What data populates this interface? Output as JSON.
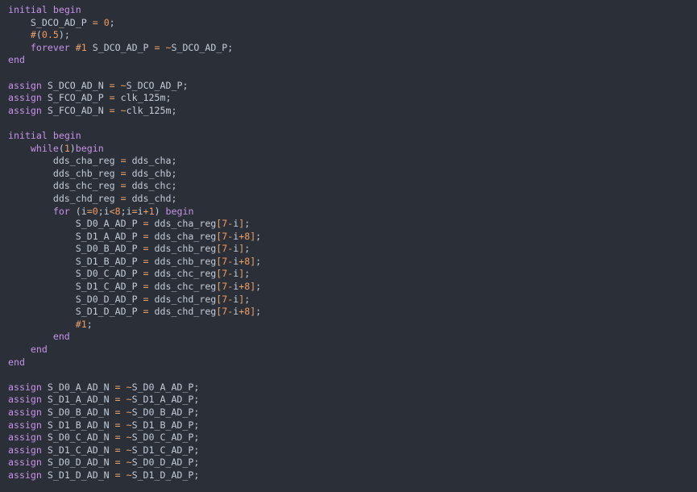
{
  "colors": {
    "background": "#2b2f37",
    "keyword": "#c792ea",
    "number": "#f59a5f",
    "operator": "#e8a36d",
    "identifier": "#c3ccd8"
  },
  "code_lines": [
    [
      {
        "k": "kw",
        "t": "initial"
      },
      {
        "k": "ws",
        "t": " "
      },
      {
        "k": "kw",
        "t": "begin"
      }
    ],
    [
      {
        "k": "ws",
        "t": "    "
      },
      {
        "k": "id",
        "t": "S_DCO_AD_P"
      },
      {
        "k": "ws",
        "t": " "
      },
      {
        "k": "op",
        "t": "="
      },
      {
        "k": "ws",
        "t": " "
      },
      {
        "k": "num",
        "t": "0"
      },
      {
        "k": "punc",
        "t": ";"
      }
    ],
    [
      {
        "k": "ws",
        "t": "    "
      },
      {
        "k": "op",
        "t": "#"
      },
      {
        "k": "punc",
        "t": "("
      },
      {
        "k": "num",
        "t": "0.5"
      },
      {
        "k": "punc",
        "t": ");"
      }
    ],
    [
      {
        "k": "ws",
        "t": "    "
      },
      {
        "k": "kw",
        "t": "forever"
      },
      {
        "k": "ws",
        "t": " "
      },
      {
        "k": "op",
        "t": "#"
      },
      {
        "k": "num",
        "t": "1"
      },
      {
        "k": "ws",
        "t": " "
      },
      {
        "k": "id",
        "t": "S_DCO_AD_P"
      },
      {
        "k": "ws",
        "t": " "
      },
      {
        "k": "op",
        "t": "="
      },
      {
        "k": "ws",
        "t": " "
      },
      {
        "k": "op",
        "t": "~"
      },
      {
        "k": "id",
        "t": "S_DCO_AD_P"
      },
      {
        "k": "punc",
        "t": ";"
      }
    ],
    [
      {
        "k": "kw",
        "t": "end"
      }
    ],
    [],
    [
      {
        "k": "kw",
        "t": "assign"
      },
      {
        "k": "ws",
        "t": " "
      },
      {
        "k": "id",
        "t": "S_DCO_AD_N"
      },
      {
        "k": "ws",
        "t": " "
      },
      {
        "k": "op",
        "t": "="
      },
      {
        "k": "ws",
        "t": " "
      },
      {
        "k": "op",
        "t": "~"
      },
      {
        "k": "id",
        "t": "S_DCO_AD_P"
      },
      {
        "k": "punc",
        "t": ";"
      }
    ],
    [
      {
        "k": "kw",
        "t": "assign"
      },
      {
        "k": "ws",
        "t": " "
      },
      {
        "k": "id",
        "t": "S_FCO_AD_P"
      },
      {
        "k": "ws",
        "t": " "
      },
      {
        "k": "op",
        "t": "="
      },
      {
        "k": "ws",
        "t": " "
      },
      {
        "k": "id",
        "t": "clk_125m"
      },
      {
        "k": "punc",
        "t": ";"
      }
    ],
    [
      {
        "k": "kw",
        "t": "assign"
      },
      {
        "k": "ws",
        "t": " "
      },
      {
        "k": "id",
        "t": "S_FCO_AD_N"
      },
      {
        "k": "ws",
        "t": " "
      },
      {
        "k": "op",
        "t": "="
      },
      {
        "k": "ws",
        "t": " "
      },
      {
        "k": "op",
        "t": "~"
      },
      {
        "k": "id",
        "t": "clk_125m"
      },
      {
        "k": "punc",
        "t": ";"
      }
    ],
    [],
    [
      {
        "k": "kw",
        "t": "initial"
      },
      {
        "k": "ws",
        "t": " "
      },
      {
        "k": "kw",
        "t": "begin"
      }
    ],
    [
      {
        "k": "ws",
        "t": "    "
      },
      {
        "k": "kw",
        "t": "while"
      },
      {
        "k": "punc",
        "t": "("
      },
      {
        "k": "num",
        "t": "1"
      },
      {
        "k": "punc",
        "t": ")"
      },
      {
        "k": "kw",
        "t": "begin"
      }
    ],
    [
      {
        "k": "ws",
        "t": "        "
      },
      {
        "k": "id",
        "t": "dds_cha_reg"
      },
      {
        "k": "ws",
        "t": " "
      },
      {
        "k": "op",
        "t": "="
      },
      {
        "k": "ws",
        "t": " "
      },
      {
        "k": "id",
        "t": "dds_cha"
      },
      {
        "k": "punc",
        "t": ";"
      }
    ],
    [
      {
        "k": "ws",
        "t": "        "
      },
      {
        "k": "id",
        "t": "dds_chb_reg"
      },
      {
        "k": "ws",
        "t": " "
      },
      {
        "k": "op",
        "t": "="
      },
      {
        "k": "ws",
        "t": " "
      },
      {
        "k": "id",
        "t": "dds_chb"
      },
      {
        "k": "punc",
        "t": ";"
      }
    ],
    [
      {
        "k": "ws",
        "t": "        "
      },
      {
        "k": "id",
        "t": "dds_chc_reg"
      },
      {
        "k": "ws",
        "t": " "
      },
      {
        "k": "op",
        "t": "="
      },
      {
        "k": "ws",
        "t": " "
      },
      {
        "k": "id",
        "t": "dds_chc"
      },
      {
        "k": "punc",
        "t": ";"
      }
    ],
    [
      {
        "k": "ws",
        "t": "        "
      },
      {
        "k": "id",
        "t": "dds_chd_reg"
      },
      {
        "k": "ws",
        "t": " "
      },
      {
        "k": "op",
        "t": "="
      },
      {
        "k": "ws",
        "t": " "
      },
      {
        "k": "id",
        "t": "dds_chd"
      },
      {
        "k": "punc",
        "t": ";"
      }
    ],
    [
      {
        "k": "ws",
        "t": "        "
      },
      {
        "k": "kw",
        "t": "for"
      },
      {
        "k": "ws",
        "t": " "
      },
      {
        "k": "punc",
        "t": "("
      },
      {
        "k": "id",
        "t": "i"
      },
      {
        "k": "op",
        "t": "="
      },
      {
        "k": "num",
        "t": "0"
      },
      {
        "k": "punc",
        "t": ";"
      },
      {
        "k": "id",
        "t": "i"
      },
      {
        "k": "op",
        "t": "<"
      },
      {
        "k": "num",
        "t": "8"
      },
      {
        "k": "punc",
        "t": ";"
      },
      {
        "k": "id",
        "t": "i"
      },
      {
        "k": "op",
        "t": "="
      },
      {
        "k": "id",
        "t": "i"
      },
      {
        "k": "op",
        "t": "+"
      },
      {
        "k": "num",
        "t": "1"
      },
      {
        "k": "punc",
        "t": ")"
      },
      {
        "k": "ws",
        "t": " "
      },
      {
        "k": "kw",
        "t": "begin"
      }
    ],
    [
      {
        "k": "ws",
        "t": "            "
      },
      {
        "k": "id",
        "t": "S_D0_A_AD_P"
      },
      {
        "k": "ws",
        "t": " "
      },
      {
        "k": "op",
        "t": "="
      },
      {
        "k": "ws",
        "t": " "
      },
      {
        "k": "id",
        "t": "dds_cha_reg"
      },
      {
        "k": "op",
        "t": "["
      },
      {
        "k": "num",
        "t": "7"
      },
      {
        "k": "op",
        "t": "-"
      },
      {
        "k": "id",
        "t": "i"
      },
      {
        "k": "op",
        "t": "]"
      },
      {
        "k": "punc",
        "t": ";"
      }
    ],
    [
      {
        "k": "ws",
        "t": "            "
      },
      {
        "k": "id",
        "t": "S_D1_A_AD_P"
      },
      {
        "k": "ws",
        "t": " "
      },
      {
        "k": "op",
        "t": "="
      },
      {
        "k": "ws",
        "t": " "
      },
      {
        "k": "id",
        "t": "dds_cha_reg"
      },
      {
        "k": "op",
        "t": "["
      },
      {
        "k": "num",
        "t": "7"
      },
      {
        "k": "op",
        "t": "-"
      },
      {
        "k": "id",
        "t": "i"
      },
      {
        "k": "op",
        "t": "+"
      },
      {
        "k": "num",
        "t": "8"
      },
      {
        "k": "op",
        "t": "]"
      },
      {
        "k": "punc",
        "t": ";"
      }
    ],
    [
      {
        "k": "ws",
        "t": "            "
      },
      {
        "k": "id",
        "t": "S_D0_B_AD_P"
      },
      {
        "k": "ws",
        "t": " "
      },
      {
        "k": "op",
        "t": "="
      },
      {
        "k": "ws",
        "t": " "
      },
      {
        "k": "id",
        "t": "dds_chb_reg"
      },
      {
        "k": "op",
        "t": "["
      },
      {
        "k": "num",
        "t": "7"
      },
      {
        "k": "op",
        "t": "-"
      },
      {
        "k": "id",
        "t": "i"
      },
      {
        "k": "op",
        "t": "]"
      },
      {
        "k": "punc",
        "t": ";"
      }
    ],
    [
      {
        "k": "ws",
        "t": "            "
      },
      {
        "k": "id",
        "t": "S_D1_B_AD_P"
      },
      {
        "k": "ws",
        "t": " "
      },
      {
        "k": "op",
        "t": "="
      },
      {
        "k": "ws",
        "t": " "
      },
      {
        "k": "id",
        "t": "dds_chb_reg"
      },
      {
        "k": "op",
        "t": "["
      },
      {
        "k": "num",
        "t": "7"
      },
      {
        "k": "op",
        "t": "-"
      },
      {
        "k": "id",
        "t": "i"
      },
      {
        "k": "op",
        "t": "+"
      },
      {
        "k": "num",
        "t": "8"
      },
      {
        "k": "op",
        "t": "]"
      },
      {
        "k": "punc",
        "t": ";"
      }
    ],
    [
      {
        "k": "ws",
        "t": "            "
      },
      {
        "k": "id",
        "t": "S_D0_C_AD_P"
      },
      {
        "k": "ws",
        "t": " "
      },
      {
        "k": "op",
        "t": "="
      },
      {
        "k": "ws",
        "t": " "
      },
      {
        "k": "id",
        "t": "dds_chc_reg"
      },
      {
        "k": "op",
        "t": "["
      },
      {
        "k": "num",
        "t": "7"
      },
      {
        "k": "op",
        "t": "-"
      },
      {
        "k": "id",
        "t": "i"
      },
      {
        "k": "op",
        "t": "]"
      },
      {
        "k": "punc",
        "t": ";"
      }
    ],
    [
      {
        "k": "ws",
        "t": "            "
      },
      {
        "k": "id",
        "t": "S_D1_C_AD_P"
      },
      {
        "k": "ws",
        "t": " "
      },
      {
        "k": "op",
        "t": "="
      },
      {
        "k": "ws",
        "t": " "
      },
      {
        "k": "id",
        "t": "dds_chc_reg"
      },
      {
        "k": "op",
        "t": "["
      },
      {
        "k": "num",
        "t": "7"
      },
      {
        "k": "op",
        "t": "-"
      },
      {
        "k": "id",
        "t": "i"
      },
      {
        "k": "op",
        "t": "+"
      },
      {
        "k": "num",
        "t": "8"
      },
      {
        "k": "op",
        "t": "]"
      },
      {
        "k": "punc",
        "t": ";"
      }
    ],
    [
      {
        "k": "ws",
        "t": "            "
      },
      {
        "k": "id",
        "t": "S_D0_D_AD_P"
      },
      {
        "k": "ws",
        "t": " "
      },
      {
        "k": "op",
        "t": "="
      },
      {
        "k": "ws",
        "t": " "
      },
      {
        "k": "id",
        "t": "dds_chd_reg"
      },
      {
        "k": "op",
        "t": "["
      },
      {
        "k": "num",
        "t": "7"
      },
      {
        "k": "op",
        "t": "-"
      },
      {
        "k": "id",
        "t": "i"
      },
      {
        "k": "op",
        "t": "]"
      },
      {
        "k": "punc",
        "t": ";"
      }
    ],
    [
      {
        "k": "ws",
        "t": "            "
      },
      {
        "k": "id",
        "t": "S_D1_D_AD_P"
      },
      {
        "k": "ws",
        "t": " "
      },
      {
        "k": "op",
        "t": "="
      },
      {
        "k": "ws",
        "t": " "
      },
      {
        "k": "id",
        "t": "dds_chd_reg"
      },
      {
        "k": "op",
        "t": "["
      },
      {
        "k": "num",
        "t": "7"
      },
      {
        "k": "op",
        "t": "-"
      },
      {
        "k": "id",
        "t": "i"
      },
      {
        "k": "op",
        "t": "+"
      },
      {
        "k": "num",
        "t": "8"
      },
      {
        "k": "op",
        "t": "]"
      },
      {
        "k": "punc",
        "t": ";"
      }
    ],
    [
      {
        "k": "ws",
        "t": "            "
      },
      {
        "k": "op",
        "t": "#"
      },
      {
        "k": "num",
        "t": "1"
      },
      {
        "k": "punc",
        "t": ";"
      }
    ],
    [
      {
        "k": "ws",
        "t": "        "
      },
      {
        "k": "kw",
        "t": "end"
      }
    ],
    [
      {
        "k": "ws",
        "t": "    "
      },
      {
        "k": "kw",
        "t": "end"
      }
    ],
    [
      {
        "k": "kw",
        "t": "end"
      }
    ],
    [],
    [
      {
        "k": "kw",
        "t": "assign"
      },
      {
        "k": "ws",
        "t": " "
      },
      {
        "k": "id",
        "t": "S_D0_A_AD_N"
      },
      {
        "k": "ws",
        "t": " "
      },
      {
        "k": "op",
        "t": "="
      },
      {
        "k": "ws",
        "t": " "
      },
      {
        "k": "op",
        "t": "~"
      },
      {
        "k": "id",
        "t": "S_D0_A_AD_P"
      },
      {
        "k": "punc",
        "t": ";"
      }
    ],
    [
      {
        "k": "kw",
        "t": "assign"
      },
      {
        "k": "ws",
        "t": " "
      },
      {
        "k": "id",
        "t": "S_D1_A_AD_N"
      },
      {
        "k": "ws",
        "t": " "
      },
      {
        "k": "op",
        "t": "="
      },
      {
        "k": "ws",
        "t": " "
      },
      {
        "k": "op",
        "t": "~"
      },
      {
        "k": "id",
        "t": "S_D1_A_AD_P"
      },
      {
        "k": "punc",
        "t": ";"
      }
    ],
    [
      {
        "k": "kw",
        "t": "assign"
      },
      {
        "k": "ws",
        "t": " "
      },
      {
        "k": "id",
        "t": "S_D0_B_AD_N"
      },
      {
        "k": "ws",
        "t": " "
      },
      {
        "k": "op",
        "t": "="
      },
      {
        "k": "ws",
        "t": " "
      },
      {
        "k": "op",
        "t": "~"
      },
      {
        "k": "id",
        "t": "S_D0_B_AD_P"
      },
      {
        "k": "punc",
        "t": ";"
      }
    ],
    [
      {
        "k": "kw",
        "t": "assign"
      },
      {
        "k": "ws",
        "t": " "
      },
      {
        "k": "id",
        "t": "S_D1_B_AD_N"
      },
      {
        "k": "ws",
        "t": " "
      },
      {
        "k": "op",
        "t": "="
      },
      {
        "k": "ws",
        "t": " "
      },
      {
        "k": "op",
        "t": "~"
      },
      {
        "k": "id",
        "t": "S_D1_B_AD_P"
      },
      {
        "k": "punc",
        "t": ";"
      }
    ],
    [
      {
        "k": "kw",
        "t": "assign"
      },
      {
        "k": "ws",
        "t": " "
      },
      {
        "k": "id",
        "t": "S_D0_C_AD_N"
      },
      {
        "k": "ws",
        "t": " "
      },
      {
        "k": "op",
        "t": "="
      },
      {
        "k": "ws",
        "t": " "
      },
      {
        "k": "op",
        "t": "~"
      },
      {
        "k": "id",
        "t": "S_D0_C_AD_P"
      },
      {
        "k": "punc",
        "t": ";"
      }
    ],
    [
      {
        "k": "kw",
        "t": "assign"
      },
      {
        "k": "ws",
        "t": " "
      },
      {
        "k": "id",
        "t": "S_D1_C_AD_N"
      },
      {
        "k": "ws",
        "t": " "
      },
      {
        "k": "op",
        "t": "="
      },
      {
        "k": "ws",
        "t": " "
      },
      {
        "k": "op",
        "t": "~"
      },
      {
        "k": "id",
        "t": "S_D1_C_AD_P"
      },
      {
        "k": "punc",
        "t": ";"
      }
    ],
    [
      {
        "k": "kw",
        "t": "assign"
      },
      {
        "k": "ws",
        "t": " "
      },
      {
        "k": "id",
        "t": "S_D0_D_AD_N"
      },
      {
        "k": "ws",
        "t": " "
      },
      {
        "k": "op",
        "t": "="
      },
      {
        "k": "ws",
        "t": " "
      },
      {
        "k": "op",
        "t": "~"
      },
      {
        "k": "id",
        "t": "S_D0_D_AD_P"
      },
      {
        "k": "punc",
        "t": ";"
      }
    ],
    [
      {
        "k": "kw",
        "t": "assign"
      },
      {
        "k": "ws",
        "t": " "
      },
      {
        "k": "id",
        "t": "S_D1_D_AD_N"
      },
      {
        "k": "ws",
        "t": " "
      },
      {
        "k": "op",
        "t": "="
      },
      {
        "k": "ws",
        "t": " "
      },
      {
        "k": "op",
        "t": "~"
      },
      {
        "k": "id",
        "t": "S_D1_D_AD_P"
      },
      {
        "k": "punc",
        "t": ";"
      }
    ]
  ]
}
